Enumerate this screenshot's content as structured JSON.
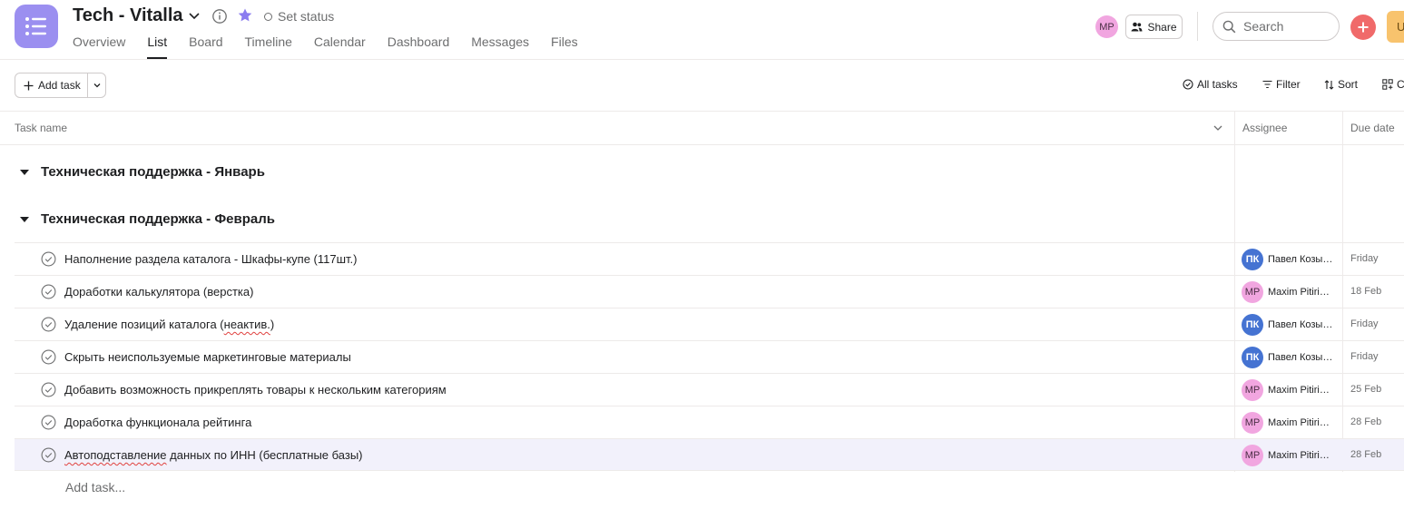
{
  "header": {
    "project_title": "Tech - Vitalla",
    "set_status": "Set status",
    "tabs": [
      "Overview",
      "List",
      "Board",
      "Timeline",
      "Calendar",
      "Dashboard",
      "Messages",
      "Files"
    ],
    "active_tab": "List",
    "user_initials": "MP",
    "share_label": "Share",
    "search_placeholder": "Search",
    "upgrade_label": "U"
  },
  "toolbar": {
    "add_task_label": "Add task",
    "all_tasks_label": "All tasks",
    "filter_label": "Filter",
    "sort_label": "Sort",
    "customize_label": "C"
  },
  "columns": {
    "task_name": "Task name",
    "assignee": "Assignee",
    "due_date": "Due date"
  },
  "sections": [
    {
      "title": "Техническая поддержка - Январь"
    },
    {
      "title": "Техническая поддержка - Февраль"
    }
  ],
  "tasks": [
    {
      "name": "Наполнение раздела каталога - Шкафы-купе (117шт.)",
      "assignee_initials": "ПК",
      "assignee_name": "Павел Козырев",
      "due": "Friday"
    },
    {
      "name": "Доработки калькулятора (верстка)",
      "assignee_initials": "MP",
      "assignee_name": "Maxim Pitirimov",
      "due": "18 Feb"
    },
    {
      "name_parts": [
        "Удаление позиций каталога (",
        "неактив.",
        ")"
      ],
      "assignee_initials": "ПК",
      "assignee_name": "Павел Козырев",
      "due": "Friday"
    },
    {
      "name": "Скрыть неиспользуемые маркетинговые материалы",
      "assignee_initials": "ПК",
      "assignee_name": "Павел Козырев",
      "due": "Friday"
    },
    {
      "name": "Добавить возможность прикреплять товары к нескольким категориям",
      "assignee_initials": "MP",
      "assignee_name": "Maxim Pitirimov",
      "due": "25 Feb"
    },
    {
      "name": "Доработка функционала рейтинга",
      "assignee_initials": "MP",
      "assignee_name": "Maxim Pitirimov",
      "due": "28 Feb"
    },
    {
      "name_parts": [
        "Автоподставление",
        " данных по ИНН (бесплатные базы)"
      ],
      "assignee_initials": "MP",
      "assignee_name": "Maxim Pitirimov",
      "due": "28 Feb"
    }
  ],
  "add_task_placeholder": "Add task...",
  "colors": {
    "app_icon": "#9b8ff0",
    "star": "#8b7cf0",
    "add_button": "#f06a6a",
    "upgrade": "#f8c36d",
    "avatar_pk": "#4573d2",
    "avatar_mp": "#f1a6e0",
    "highlight_row": "#f2f1fb"
  },
  "icons": [
    "list-icon",
    "chevron-down-icon",
    "info-icon",
    "star-icon",
    "status-circle-icon",
    "share-people-icon",
    "search-icon",
    "plus-icon",
    "check-circle-icon",
    "filter-icon",
    "sort-icon",
    "customize-icon",
    "caret-down-icon"
  ]
}
